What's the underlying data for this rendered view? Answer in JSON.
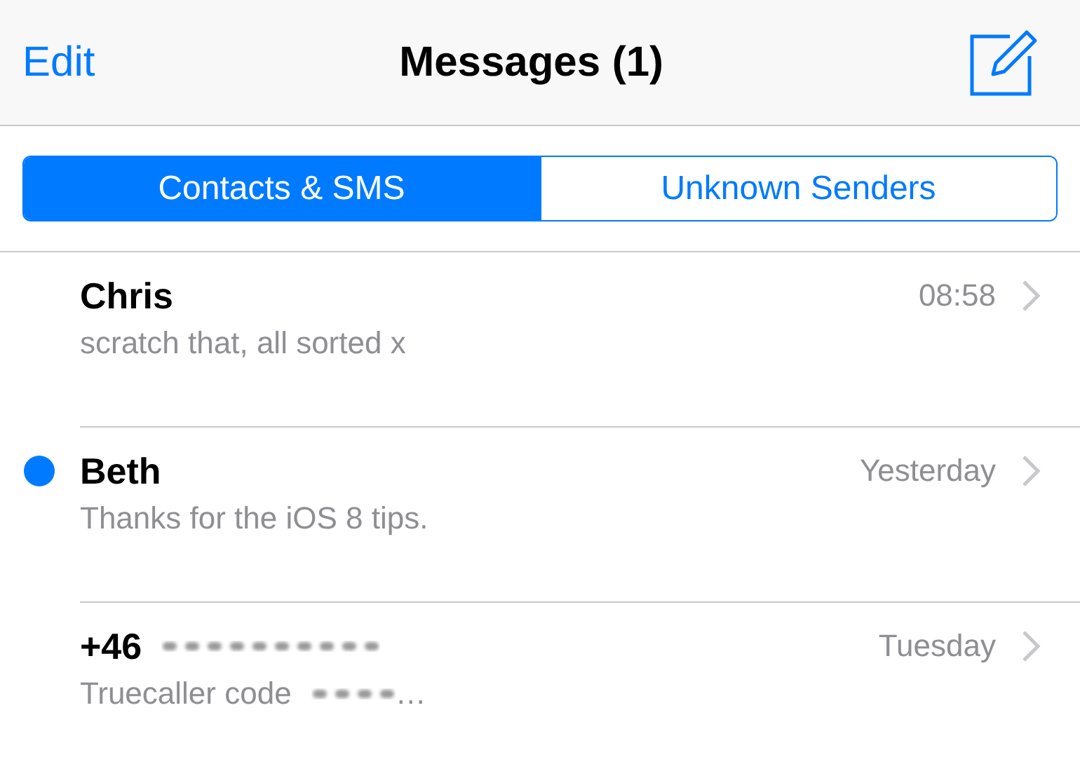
{
  "nav": {
    "edit": "Edit",
    "title": "Messages (1)"
  },
  "segments": [
    {
      "label": "Contacts & SMS",
      "selected": true
    },
    {
      "label": "Unknown Senders",
      "selected": false
    }
  ],
  "messages": [
    {
      "name": "Chris",
      "time": "08:58",
      "preview": "scratch that, all sorted x",
      "unread": false
    },
    {
      "name": "Beth",
      "time": "Yesterday",
      "preview": "Thanks for the iOS 8 tips.",
      "unread": true
    },
    {
      "name": "+46",
      "name_redacted": true,
      "time": "Tuesday",
      "preview": "Truecaller code",
      "preview_redacted": true,
      "preview_end": "…",
      "unread": false
    }
  ]
}
